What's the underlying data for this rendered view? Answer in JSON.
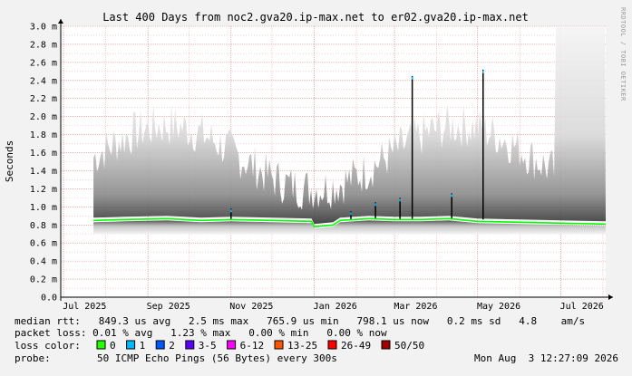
{
  "colors": {
    "background": "#f2f2f2",
    "plot_background": "#ffffff",
    "grid_minor": "#f0b0b0",
    "grid_major": "#e08080",
    "median_line": "#00ff00",
    "smoke_dark": "#222222",
    "spike": "#000000",
    "spike_highlight": "#00c0ff"
  },
  "chart_data": {
    "type": "area",
    "title": "Last 400 Days from noc2.gva20.ip-max.net to er02.gva20.ip-max.net",
    "ylabel": "Seconds",
    "xlabel": "",
    "ylim": [
      0,
      3.0
    ],
    "yticks": [
      "0.0",
      "0.2 m",
      "0.4 m",
      "0.6 m",
      "0.8 m",
      "1.0 m",
      "1.2 m",
      "1.4 m",
      "1.6 m",
      "1.8 m",
      "2.0 m",
      "2.2 m",
      "2.4 m",
      "2.6 m",
      "2.8 m",
      "3.0 m"
    ],
    "xticks": [
      "Jul 2025",
      "Sep 2025",
      "Nov 2025",
      "Jan 2026",
      "Mar 2026",
      "May 2026",
      "Jul 2026"
    ],
    "grid": true,
    "watermark": "RRDTOOL / TOBI OETIKER",
    "series": [
      {
        "name": "median rtt",
        "x": [
          "2025-07-23",
          "2025-08-15",
          "2025-09-15",
          "2025-10-10",
          "2025-11-01",
          "2025-12-01",
          "2025-12-30",
          "2026-01-01",
          "2026-01-15",
          "2026-01-20",
          "2026-02-10",
          "2026-03-01",
          "2026-03-20",
          "2026-04-10",
          "2026-05-01",
          "2026-06-01",
          "2026-07-01",
          "2026-08-03"
        ],
        "values": [
          0.85,
          0.86,
          0.87,
          0.85,
          0.86,
          0.85,
          0.84,
          0.78,
          0.8,
          0.85,
          0.87,
          0.86,
          0.86,
          0.87,
          0.84,
          0.83,
          0.82,
          0.81
        ]
      }
    ],
    "spikes": [
      {
        "date": "2025-11-01",
        "value": 0.98
      },
      {
        "date": "2026-01-28",
        "value": 0.95
      },
      {
        "date": "2026-02-15",
        "value": 1.05
      },
      {
        "date": "2026-03-05",
        "value": 1.1
      },
      {
        "date": "2026-03-14",
        "value": 2.45
      },
      {
        "date": "2026-04-12",
        "value": 1.15
      },
      {
        "date": "2026-05-05",
        "value": 2.52
      }
    ]
  },
  "legend": {
    "median_rtt": "median rtt:   849.3 us avg   2.5 ms max   765.9 us min   798.1 us now   0.2 ms sd   4.8    am/s",
    "packet_loss": "packet loss: 0.01 % avg   1.23 % max   0.00 % min   0.00 % now",
    "loss_color_label": "loss color:",
    "loss_colors": [
      {
        "label": "0",
        "color": "#26ff00"
      },
      {
        "label": "1",
        "color": "#00b8ff"
      },
      {
        "label": "2",
        "color": "#0059ff"
      },
      {
        "label": "3-5",
        "color": "#5e00ff"
      },
      {
        "label": "6-12",
        "color": "#ff00ff"
      },
      {
        "label": "13-25",
        "color": "#ff5500"
      },
      {
        "label": "26-49",
        "color": "#ff0000"
      },
      {
        "label": "50/50",
        "color": "#a10000"
      }
    ],
    "probe_label": "probe:",
    "probe": "50 ICMP Echo Pings (56 Bytes) every 300s",
    "timestamp": "Mon Aug  3 12:27:09 2026"
  }
}
